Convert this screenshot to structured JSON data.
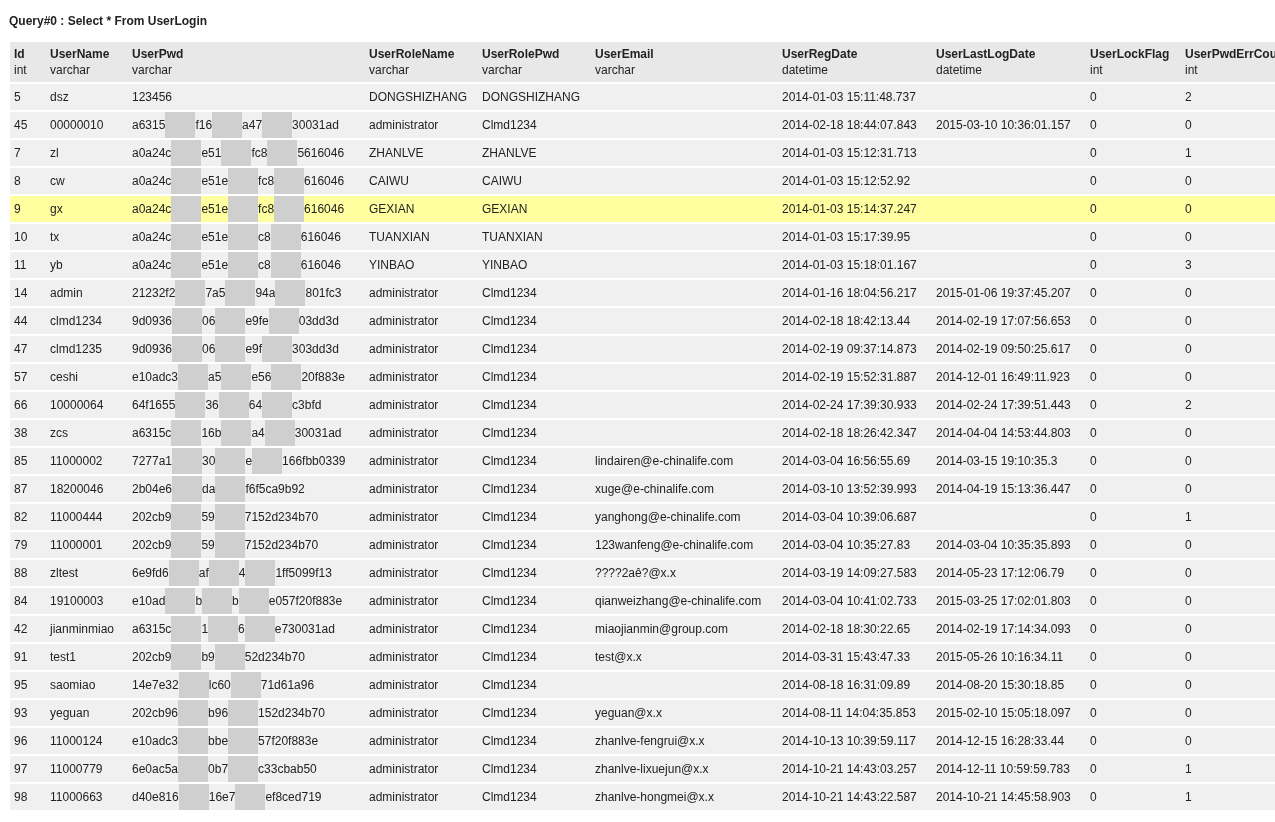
{
  "title": "Query#0 : Select * From UserLogin",
  "columns": [
    {
      "name": "Id",
      "type": "int"
    },
    {
      "name": "UserName",
      "type": "varchar"
    },
    {
      "name": "UserPwd",
      "type": "varchar"
    },
    {
      "name": "UserRoleName",
      "type": "varchar"
    },
    {
      "name": "UserRolePwd",
      "type": "varchar"
    },
    {
      "name": "UserEmail",
      "type": "varchar"
    },
    {
      "name": "UserRegDate",
      "type": "datetime"
    },
    {
      "name": "UserLastLogDate",
      "type": "datetime"
    },
    {
      "name": "UserLockFlag",
      "type": "int"
    },
    {
      "name": "UserPwdErrCou",
      "type": "int"
    }
  ],
  "rows": [
    {
      "selected": false,
      "id": "5",
      "name": "dsz",
      "pwd": [
        "123456"
      ],
      "role": "DONGSHIZHANG",
      "role_pwd": "DONGSHIZHANG",
      "reg": "2014-01-03 15:11:48.737",
      "lock": "0",
      "err": "2"
    },
    {
      "selected": false,
      "id": "45",
      "name": "00000010",
      "pwd": [
        "a6315",
        "f16",
        "a47",
        "30031ad"
      ],
      "role": "administrator",
      "role_pwd": "Clmd1234",
      "reg": "2014-02-18 18:44:07.843",
      "last": "2015-03-10 10:36:01.157",
      "lock": "0",
      "err": "0"
    },
    {
      "selected": false,
      "id": "7",
      "name": "zl",
      "pwd": [
        "a0a24c",
        "e51",
        "fc8",
        "5616046"
      ],
      "role": "ZHANLVE",
      "role_pwd": "ZHANLVE",
      "reg": "2014-01-03 15:12:31.713",
      "lock": "0",
      "err": "1"
    },
    {
      "selected": false,
      "id": "8",
      "name": "cw",
      "pwd": [
        "a0a24c",
        "e51e",
        "fc8",
        "616046"
      ],
      "role": "CAIWU",
      "role_pwd": "CAIWU",
      "reg": "2014-01-03 15:12:52.92",
      "lock": "0",
      "err": "0"
    },
    {
      "selected": true,
      "id": "9",
      "name": "gx",
      "pwd": [
        "a0a24c",
        "e51e",
        "fc8",
        "616046"
      ],
      "role": "GEXIAN",
      "role_pwd": "GEXIAN",
      "reg": "2014-01-03 15:14:37.247",
      "lock": "0",
      "err": "0"
    },
    {
      "selected": false,
      "id": "10",
      "name": "tx",
      "pwd": [
        "a0a24c",
        "e51e",
        "c8",
        "616046"
      ],
      "role": "TUANXIAN",
      "role_pwd": "TUANXIAN",
      "reg": "2014-01-03 15:17:39.95",
      "lock": "0",
      "err": "0"
    },
    {
      "selected": false,
      "id": "11",
      "name": "yb",
      "pwd": [
        "a0a24c",
        "e51e",
        "c8",
        "616046"
      ],
      "role": "YINBAO",
      "role_pwd": "YINBAO",
      "reg": "2014-01-03 15:18:01.167",
      "lock": "0",
      "err": "3"
    },
    {
      "selected": false,
      "id": "14",
      "name": "admin",
      "pwd": [
        "21232f2",
        "7a5",
        "94a",
        "801fc3"
      ],
      "role": "administrator",
      "role_pwd": "Clmd1234",
      "reg": "2014-01-16 18:04:56.217",
      "last": "2015-01-06 19:37:45.207",
      "lock": "0",
      "err": "0"
    },
    {
      "selected": false,
      "id": "44",
      "name": "clmd1234",
      "pwd": [
        "9d0936",
        "06",
        "e9fe",
        "03dd3d"
      ],
      "role": "administrator",
      "role_pwd": "Clmd1234",
      "reg": "2014-02-18 18:42:13.44",
      "last": "2014-02-19 17:07:56.653",
      "lock": "0",
      "err": "0"
    },
    {
      "selected": false,
      "id": "47",
      "name": "clmd1235",
      "pwd": [
        "9d0936",
        "06",
        "e9f",
        "303dd3d"
      ],
      "role": "administrator",
      "role_pwd": "Clmd1234",
      "reg": "2014-02-19 09:37:14.873",
      "last": "2014-02-19 09:50:25.617",
      "lock": "0",
      "err": "0"
    },
    {
      "selected": false,
      "id": "57",
      "name": "ceshi",
      "pwd": [
        "e10adc3",
        "a5",
        "e56",
        "20f883e"
      ],
      "role": "administrator",
      "role_pwd": "Clmd1234",
      "reg": "2014-02-19 15:52:31.887",
      "last": "2014-12-01 16:49:11.923",
      "lock": "0",
      "err": "0"
    },
    {
      "selected": false,
      "id": "66",
      "name": "10000064",
      "pwd": [
        "64f1655",
        "36",
        "64",
        "c3bfd"
      ],
      "role": "administrator",
      "role_pwd": "Clmd1234",
      "reg": "2014-02-24 17:39:30.933",
      "last": "2014-02-24 17:39:51.443",
      "lock": "0",
      "err": "2"
    },
    {
      "selected": false,
      "id": "38",
      "name": "zcs",
      "pwd": [
        "a6315c",
        "16b",
        "a4",
        "30031ad"
      ],
      "role": "administrator",
      "role_pwd": "Clmd1234",
      "reg": "2014-02-18 18:26:42.347",
      "last": "2014-04-04 14:53:44.803",
      "lock": "0",
      "err": "0"
    },
    {
      "selected": false,
      "id": "85",
      "name": "11000002",
      "pwd": [
        "7277a1",
        "30",
        "e",
        "166fbb0339"
      ],
      "role": "administrator",
      "role_pwd": "Clmd1234",
      "email": "lindairen@e-chinalife.com",
      "reg": "2014-03-04 16:56:55.69",
      "last": "2014-03-15 19:10:35.3",
      "lock": "0",
      "err": "0"
    },
    {
      "selected": false,
      "id": "87",
      "name": "18200046",
      "pwd": [
        "2b04e6",
        "da",
        "f6f5ca9b92"
      ],
      "role": "administrator",
      "role_pwd": "Clmd1234",
      "email": "xuge@e-chinalife.com",
      "reg": "2014-03-10 13:52:39.993",
      "last": "2014-04-19 15:13:36.447",
      "lock": "0",
      "err": "0"
    },
    {
      "selected": false,
      "id": "82",
      "name": "11000444",
      "pwd": [
        "202cb9",
        "59",
        "7152d234b70"
      ],
      "role": "administrator",
      "role_pwd": "Clmd1234",
      "email": "yanghong@e-chinalife.com",
      "reg": "2014-03-04 10:39:06.687",
      "lock": "0",
      "err": "1"
    },
    {
      "selected": false,
      "id": "79",
      "name": "11000001",
      "pwd": [
        "202cb9",
        "59",
        "7152d234b70"
      ],
      "role": "administrator",
      "role_pwd": "Clmd1234",
      "email": "123wanfeng@e-chinalife.com",
      "reg": "2014-03-04 10:35:27.83",
      "last": "2014-03-04 10:35:35.893",
      "lock": "0",
      "err": "0"
    },
    {
      "selected": false,
      "id": "88",
      "name": "zltest",
      "pwd": [
        "6e9fd6",
        "af",
        "4",
        "1ff5099f13"
      ],
      "role": "administrator",
      "role_pwd": "Clmd1234",
      "email": "????2aê?@x.x",
      "reg": "2014-03-19 14:09:27.583",
      "last": "2014-05-23 17:12:06.79",
      "lock": "0",
      "err": "0"
    },
    {
      "selected": false,
      "id": "84",
      "name": "19100003",
      "pwd": [
        "e10ad",
        "b",
        "b",
        "e057f20f883e"
      ],
      "role": "administrator",
      "role_pwd": "Clmd1234",
      "email": "qianweizhang@e-chinalife.com",
      "reg": "2014-03-04 10:41:02.733",
      "last": "2015-03-25 17:02:01.803",
      "lock": "0",
      "err": "0"
    },
    {
      "selected": false,
      "id": "42",
      "name": "jianminmiao",
      "pwd": [
        "a6315c",
        "1",
        "6",
        "e730031ad"
      ],
      "role": "administrator",
      "role_pwd": "Clmd1234",
      "email": "miaojianmin@group.com",
      "reg": "2014-02-18 18:30:22.65",
      "last": "2014-02-19 17:14:34.093",
      "lock": "0",
      "err": "0"
    },
    {
      "selected": false,
      "id": "91",
      "name": "test1",
      "pwd": [
        "202cb9",
        "b9",
        "52d234b70"
      ],
      "role": "administrator",
      "role_pwd": "Clmd1234",
      "email": "test@x.x",
      "reg": "2014-03-31 15:43:47.33",
      "last": "2015-05-26 10:16:34.11",
      "lock": "0",
      "err": "0"
    },
    {
      "selected": false,
      "id": "95",
      "name": "saomiao",
      "pwd": [
        "14e7e32",
        "lc60",
        "71d61a96"
      ],
      "role": "administrator",
      "role_pwd": "Clmd1234",
      "reg": "2014-08-18 16:31:09.89",
      "last": "2014-08-20 15:30:18.85",
      "lock": "0",
      "err": "0"
    },
    {
      "selected": false,
      "id": "93",
      "name": "yeguan",
      "pwd": [
        "202cb96",
        "b96",
        "152d234b70"
      ],
      "role": "administrator",
      "role_pwd": "Clmd1234",
      "email": "yeguan@x.x",
      "reg": "2014-08-11 14:04:35.853",
      "last": "2015-02-10 15:05:18.097",
      "lock": "0",
      "err": "0"
    },
    {
      "selected": false,
      "id": "96",
      "name": "11000124",
      "pwd": [
        "e10adc3",
        "bbe",
        "57f20f883e"
      ],
      "role": "administrator",
      "role_pwd": "Clmd1234",
      "email": "zhanlve-fengrui@x.x",
      "reg": "2014-10-13 10:39:59.117",
      "last": "2014-12-15 16:28:33.44",
      "lock": "0",
      "err": "0"
    },
    {
      "selected": false,
      "id": "97",
      "name": "11000779",
      "pwd": [
        "6e0ac5a",
        "0b7",
        "c33cbab50"
      ],
      "role": "administrator",
      "role_pwd": "Clmd1234",
      "email": "zhanlve-lixuejun@x.x",
      "reg": "2014-10-21 14:43:03.257",
      "last": "2014-12-11 10:59:59.783",
      "lock": "0",
      "err": "1"
    },
    {
      "selected": false,
      "id": "98",
      "name": "11000663",
      "pwd": [
        "d40e816",
        "16e7",
        "ef8ced719"
      ],
      "role": "administrator",
      "role_pwd": "Clmd1234",
      "email": "zhanlve-hongmei@x.x",
      "reg": "2014-10-21 14:43:22.587",
      "last": "2014-10-21 14:45:58.903",
      "lock": "0",
      "err": "1"
    }
  ]
}
